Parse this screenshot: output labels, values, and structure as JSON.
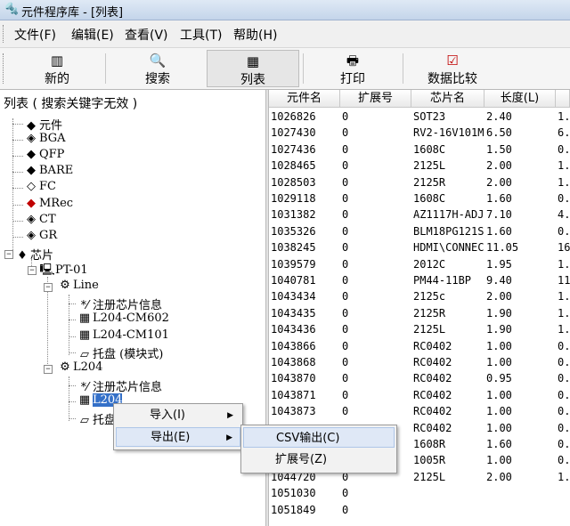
{
  "window": {
    "title": "元件程序库 - [列表]"
  },
  "menubar": {
    "items": [
      "文件(F)",
      "编辑(E)",
      "查看(V)",
      "工具(T)",
      "帮助(H)"
    ]
  },
  "toolbar": {
    "new_label": "新的",
    "search_label": "搜索",
    "list_label": "列表",
    "print_label": "打印",
    "compare_label": "数据比较"
  },
  "left_pane": {
    "header": "列表  ( 搜索关键字无效 )",
    "tree": {
      "component": "元件",
      "bga": "BGA",
      "qfp": "QFP",
      "bare": "BARE",
      "fc": "FC",
      "mrec": "MRec",
      "ct": "CT",
      "gr": "GR",
      "chip": "芯片",
      "pt01": "PT-01",
      "line": "Line",
      "reg_info_1": "注册芯片信息",
      "l204_cm602": "L204-CM602",
      "l204_cm101": "L204-CM101",
      "tray_1": "托盘 (模块式)",
      "l204": "L204",
      "reg_info_2": "注册芯片信息",
      "l204_sel": "L204",
      "tray_2": "托盘"
    }
  },
  "table": {
    "columns": [
      "元件名",
      "扩展号",
      "芯片名",
      "长度(L)",
      ""
    ],
    "rows": [
      [
        "1026826",
        "0",
        "SOT23",
        "2.40",
        "1."
      ],
      [
        "1027430",
        "0",
        "RV2-16V101M",
        "6.50",
        "6."
      ],
      [
        "1027436",
        "0",
        "1608C",
        "1.50",
        "0."
      ],
      [
        "1028465",
        "0",
        "2125L",
        "2.00",
        "1."
      ],
      [
        "1028503",
        "0",
        "2125R",
        "2.00",
        "1."
      ],
      [
        "1029118",
        "0",
        "1608C",
        "1.60",
        "0."
      ],
      [
        "1031382",
        "0",
        "AZ1117H-ADJ",
        "7.10",
        "4."
      ],
      [
        "1035326",
        "0",
        "BLM18PG121S",
        "1.60",
        "0."
      ],
      [
        "1038245",
        "0",
        "HDMI\\CONNEC",
        "11.05",
        "16"
      ],
      [
        "1039579",
        "0",
        "2012C",
        "1.95",
        "1."
      ],
      [
        "1040781",
        "0",
        "PM44-11BP",
        "9.40",
        "11"
      ],
      [
        "1043434",
        "0",
        "2125c",
        "2.00",
        "1."
      ],
      [
        "1043435",
        "0",
        "2125R",
        "1.90",
        "1."
      ],
      [
        "1043436",
        "0",
        "2125L",
        "1.90",
        "1."
      ],
      [
        "1043866",
        "0",
        "RC0402",
        "1.00",
        "0."
      ],
      [
        "1043868",
        "0",
        "RC0402",
        "1.00",
        "0."
      ],
      [
        "1043870",
        "0",
        "RC0402",
        "0.95",
        "0."
      ],
      [
        "1043871",
        "0",
        "RC0402",
        "1.00",
        "0."
      ],
      [
        "1043873",
        "0",
        "RC0402",
        "1.00",
        "0."
      ],
      [
        "",
        "",
        "RC0402",
        "1.00",
        "0."
      ],
      [
        "",
        "",
        "1608R",
        "1.60",
        "0."
      ],
      [
        "",
        "",
        "1005R",
        "1.00",
        "0."
      ],
      [
        "1044720",
        "0",
        "2125L",
        "2.00",
        "1."
      ],
      [
        "1051030",
        "0",
        "",
        "",
        ""
      ],
      [
        "1051849",
        "0",
        "",
        "",
        ""
      ]
    ]
  },
  "context_menu": {
    "import_label": "导入(I)",
    "export_label": "导出(E)",
    "submenu": {
      "csv_label": "CSV输出(C)",
      "ext_label": "扩展号(Z)"
    }
  }
}
